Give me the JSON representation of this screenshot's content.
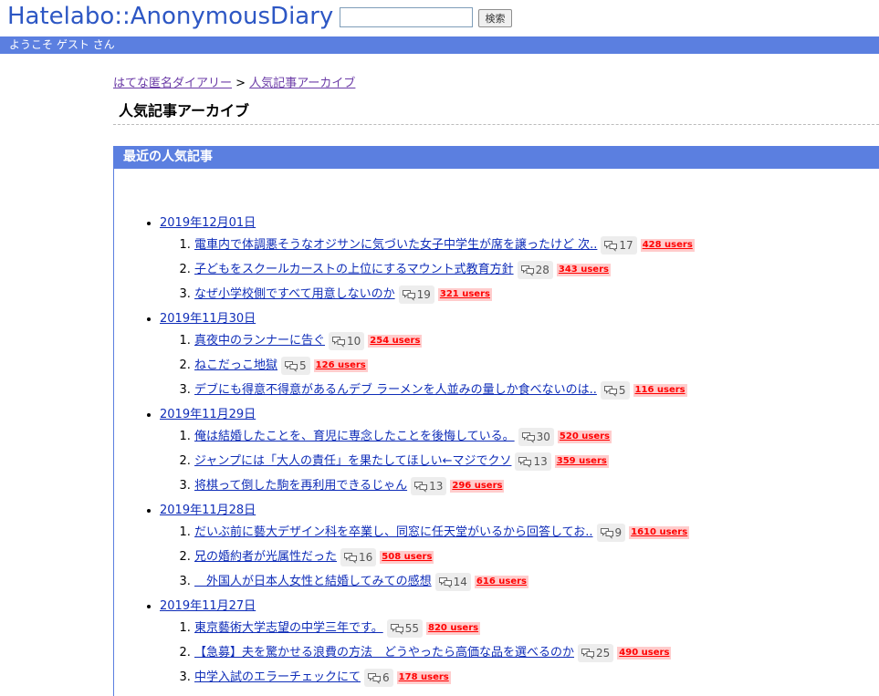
{
  "header": {
    "logo": "Hatelabo::AnonymousDiary",
    "search_value": "",
    "search_button": "検索",
    "welcome": "ようこそ ゲスト さん"
  },
  "breadcrumb": {
    "home": "はてな匿名ダイアリー",
    "separator": " > ",
    "current": "人気記事アーカイブ"
  },
  "page_title": "人気記事アーカイブ",
  "section": {
    "title": "最近の人気記事",
    "days": [
      {
        "date": "2019年12月01日",
        "entries": [
          {
            "title": "電車内で体調悪そうなオジサンに気づいた女子中学生が席を譲ったけど 次..",
            "comments": "17",
            "users": "428 users"
          },
          {
            "title": "子どもをスクールカーストの上位にするマウント式教育方針",
            "comments": "28",
            "users": "343 users"
          },
          {
            "title": "なぜ小学校側ですべて用意しないのか",
            "comments": "19",
            "users": "321 users"
          }
        ]
      },
      {
        "date": "2019年11月30日",
        "entries": [
          {
            "title": "真夜中のランナーに告ぐ",
            "comments": "10",
            "users": "254 users"
          },
          {
            "title": "ねこだっこ地獄",
            "comments": "5",
            "users": "126 users"
          },
          {
            "title": "デブにも得意不得意があるんデブ ラーメンを人並みの量しか食べないのは..",
            "comments": "5",
            "users": "116 users"
          }
        ]
      },
      {
        "date": "2019年11月29日",
        "entries": [
          {
            "title": "俺は結婚したことを、育児に専念したことを後悔している。",
            "comments": "30",
            "users": "520 users"
          },
          {
            "title": "ジャンプには「大人の責任」を果たしてほしい←マジでクソ",
            "comments": "13",
            "users": "359 users"
          },
          {
            "title": "将棋って倒した駒を再利用できるじゃん",
            "comments": "13",
            "users": "296 users"
          }
        ]
      },
      {
        "date": "2019年11月28日",
        "entries": [
          {
            "title": "だいぶ前に藝大デザイン科を卒業し、同窓に任天堂がいるから回答してお..",
            "comments": "9",
            "users": "1610 users"
          },
          {
            "title": "兄の婚約者が光属性だった",
            "comments": "16",
            "users": "508 users"
          },
          {
            "title": "　外国人が日本人女性と結婚してみての感想",
            "comments": "14",
            "users": "616 users"
          }
        ]
      },
      {
        "date": "2019年11月27日",
        "entries": [
          {
            "title": "東京藝術大学志望の中学三年です。",
            "comments": "55",
            "users": "820 users"
          },
          {
            "title": "【急募】夫を驚かせる浪費の方法　どうやったら高価な品を選べるのか",
            "comments": "25",
            "users": "490 users"
          },
          {
            "title": "中学入試のエラーチェックにて",
            "comments": "6",
            "users": "178 users"
          }
        ]
      }
    ]
  },
  "icons": {
    "comment": "comment-bubbles-icon"
  },
  "colors": {
    "brand": "#2d57c4",
    "bar": "#5b7fe0",
    "link": "#0f2db8",
    "users_text": "#ff0000",
    "users_bg": "#ffcccc"
  }
}
